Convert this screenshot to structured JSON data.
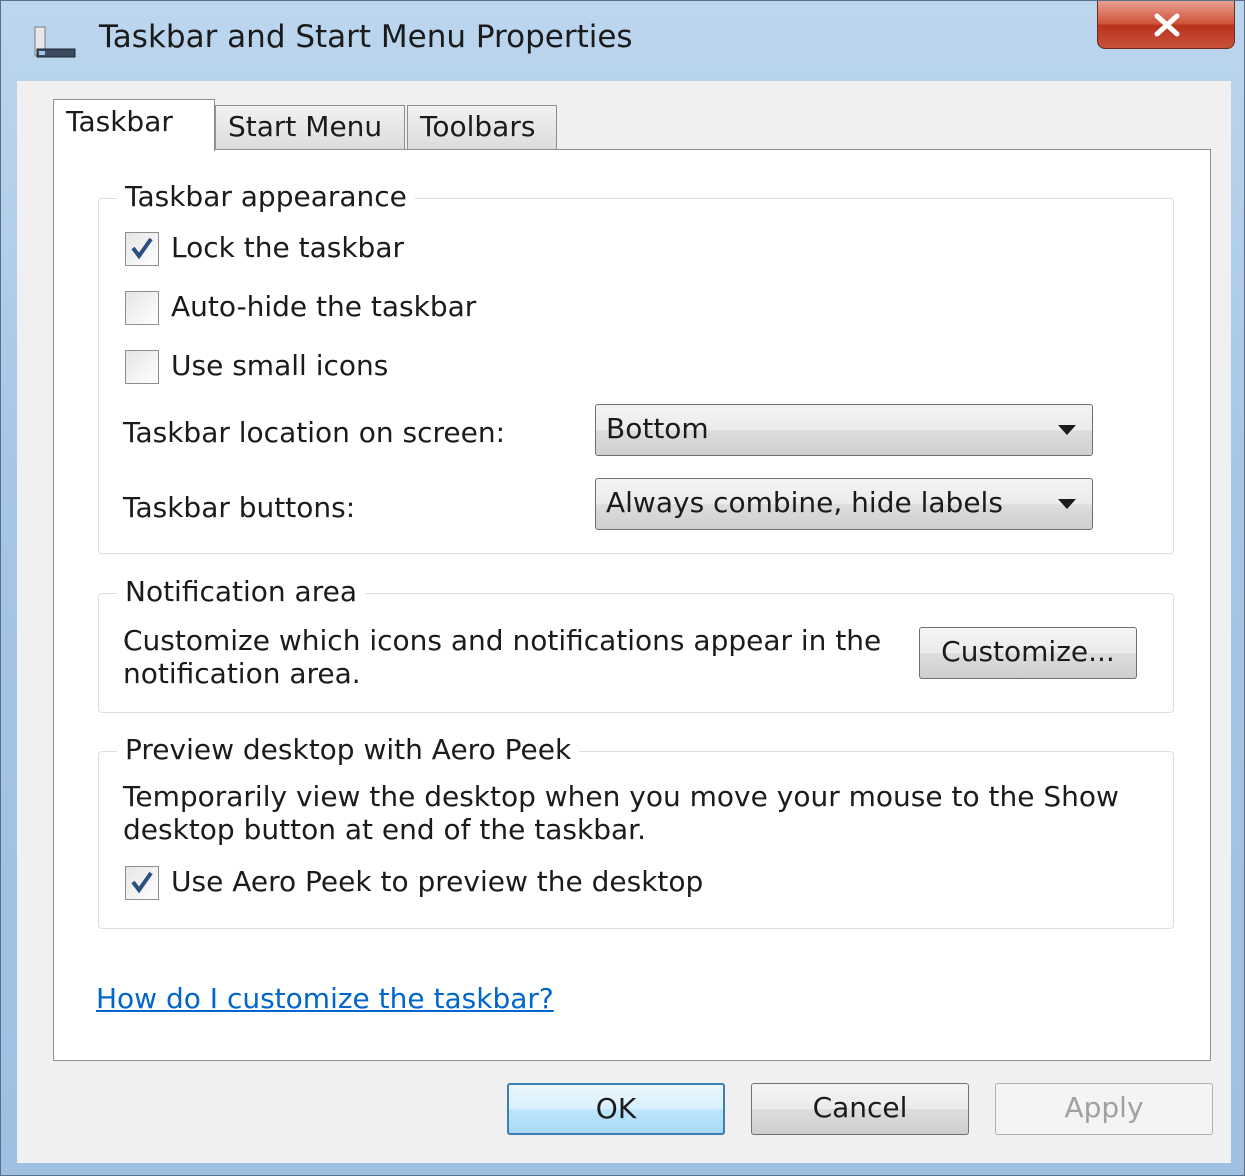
{
  "window": {
    "title": "Taskbar and Start Menu Properties",
    "close_glyph": "✕"
  },
  "tabs": [
    {
      "label": "Taskbar",
      "selected": true
    },
    {
      "label": "Start Menu",
      "selected": false
    },
    {
      "label": "Toolbars",
      "selected": false
    }
  ],
  "appearance": {
    "legend": "Taskbar appearance",
    "lock": {
      "label": "Lock the taskbar",
      "checked": true
    },
    "autohide": {
      "label": "Auto-hide the taskbar",
      "checked": false
    },
    "small_icons": {
      "label": "Use small icons",
      "checked": false
    },
    "location_label": "Taskbar location on screen:",
    "location_value": "Bottom",
    "buttons_label": "Taskbar buttons:",
    "buttons_value": "Always combine, hide labels"
  },
  "notification": {
    "legend": "Notification area",
    "description": "Customize which icons and notifications appear in the notification area.",
    "customize_label": "Customize..."
  },
  "aero_peek": {
    "legend": "Preview desktop with Aero Peek",
    "description": "Temporarily view the desktop when you move your mouse to the Show desktop button at end of the taskbar.",
    "use_peek": {
      "label": "Use Aero Peek to preview the desktop",
      "checked": true
    }
  },
  "help_link": "How do I customize the taskbar?",
  "footer": {
    "ok_label": "OK",
    "cancel_label": "Cancel",
    "apply_label": "Apply",
    "apply_enabled": false
  },
  "icons": {
    "app": "taskbar-icon",
    "close": "close-icon",
    "check": "checkmark-icon",
    "dropdown": "chevron-down-icon"
  }
}
